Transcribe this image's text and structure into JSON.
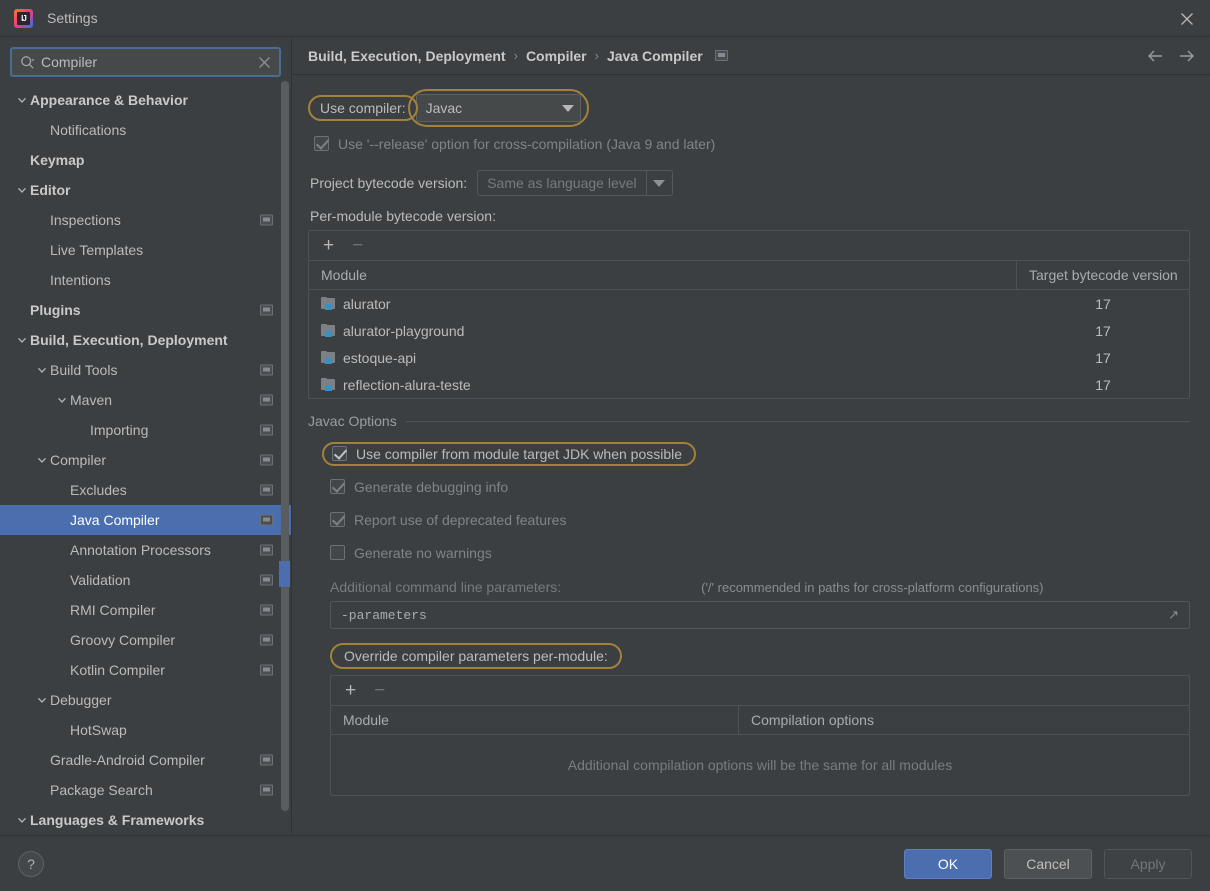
{
  "window": {
    "title": "Settings",
    "logo_icon": "intellij-idea-logo",
    "close_icon": "close-icon"
  },
  "search": {
    "value": "Compiler",
    "placeholder": "Search settings",
    "search_icon": "search-icon",
    "clear_icon": "clear-icon"
  },
  "sidebar": {
    "items": [
      {
        "label": "Appearance & Behavior",
        "indent": 0,
        "bold": true,
        "arrow": "chevron-down",
        "screen_icon": false,
        "selected": false
      },
      {
        "label": "Notifications",
        "indent": 1,
        "bold": false,
        "arrow": "none",
        "screen_icon": false,
        "selected": false
      },
      {
        "label": "Keymap",
        "indent": 0,
        "bold": true,
        "arrow": "none",
        "screen_icon": false,
        "selected": false
      },
      {
        "label": "Editor",
        "indent": 0,
        "bold": true,
        "arrow": "chevron-down",
        "screen_icon": false,
        "selected": false
      },
      {
        "label": "Inspections",
        "indent": 1,
        "bold": false,
        "arrow": "none",
        "screen_icon": true,
        "selected": false
      },
      {
        "label": "Live Templates",
        "indent": 1,
        "bold": false,
        "arrow": "none",
        "screen_icon": false,
        "selected": false
      },
      {
        "label": "Intentions",
        "indent": 1,
        "bold": false,
        "arrow": "none",
        "screen_icon": false,
        "selected": false
      },
      {
        "label": "Plugins",
        "indent": 0,
        "bold": true,
        "arrow": "none",
        "screen_icon": true,
        "selected": false
      },
      {
        "label": "Build, Execution, Deployment",
        "indent": 0,
        "bold": true,
        "arrow": "chevron-down",
        "screen_icon": false,
        "selected": false
      },
      {
        "label": "Build Tools",
        "indent": 1,
        "bold": false,
        "arrow": "chevron-down",
        "screen_icon": true,
        "selected": false
      },
      {
        "label": "Maven",
        "indent": 2,
        "bold": false,
        "arrow": "chevron-down",
        "screen_icon": true,
        "selected": false
      },
      {
        "label": "Importing",
        "indent": 3,
        "bold": false,
        "arrow": "none",
        "screen_icon": true,
        "selected": false
      },
      {
        "label": "Compiler",
        "indent": 1,
        "bold": false,
        "arrow": "chevron-down",
        "screen_icon": true,
        "selected": false
      },
      {
        "label": "Excludes",
        "indent": 2,
        "bold": false,
        "arrow": "none",
        "screen_icon": true,
        "selected": false
      },
      {
        "label": "Java Compiler",
        "indent": 2,
        "bold": false,
        "arrow": "none",
        "screen_icon": true,
        "selected": true
      },
      {
        "label": "Annotation Processors",
        "indent": 2,
        "bold": false,
        "arrow": "none",
        "screen_icon": true,
        "selected": false
      },
      {
        "label": "Validation",
        "indent": 2,
        "bold": false,
        "arrow": "none",
        "screen_icon": true,
        "selected": false
      },
      {
        "label": "RMI Compiler",
        "indent": 2,
        "bold": false,
        "arrow": "none",
        "screen_icon": true,
        "selected": false
      },
      {
        "label": "Groovy Compiler",
        "indent": 2,
        "bold": false,
        "arrow": "none",
        "screen_icon": true,
        "selected": false
      },
      {
        "label": "Kotlin Compiler",
        "indent": 2,
        "bold": false,
        "arrow": "none",
        "screen_icon": true,
        "selected": false
      },
      {
        "label": "Debugger",
        "indent": 1,
        "bold": false,
        "arrow": "chevron-down",
        "screen_icon": false,
        "selected": false
      },
      {
        "label": "HotSwap",
        "indent": 2,
        "bold": false,
        "arrow": "none",
        "screen_icon": false,
        "selected": false
      },
      {
        "label": "Gradle-Android Compiler",
        "indent": 1,
        "bold": false,
        "arrow": "none",
        "screen_icon": true,
        "selected": false
      },
      {
        "label": "Package Search",
        "indent": 1,
        "bold": false,
        "arrow": "none",
        "screen_icon": true,
        "selected": false
      },
      {
        "label": "Languages & Frameworks",
        "indent": 0,
        "bold": true,
        "arrow": "chevron-down",
        "screen_icon": false,
        "selected": false
      }
    ]
  },
  "breadcrumb": {
    "parts": [
      "Build, Execution, Deployment",
      "Compiler",
      "Java Compiler"
    ],
    "separator": "›",
    "screen_icon": "screen-icon",
    "back_icon": "arrow-left-icon",
    "forward_icon": "arrow-right-icon"
  },
  "main": {
    "use_compiler_label": "Use compiler:",
    "use_compiler_value": "Javac",
    "use_release_checkbox": {
      "label": "Use '--release' option for cross-compilation (Java 9 and later)",
      "checked": true,
      "enabled": false
    },
    "project_bytecode_label": "Project bytecode version:",
    "project_bytecode_value": "Same as language level",
    "per_module_label": "Per-module bytecode version:",
    "per_module_table": {
      "add_label": "+",
      "remove_label": "−",
      "columns": [
        "Module",
        "Target bytecode version"
      ],
      "rows": [
        {
          "module": "alurator",
          "version": "17"
        },
        {
          "module": "alurator-playground",
          "version": "17"
        },
        {
          "module": "estoque-api",
          "version": "17"
        },
        {
          "module": "reflection-alura-teste",
          "version": "17"
        }
      ]
    },
    "javac_options": {
      "title": "Javac Options",
      "checkboxes": [
        {
          "label": "Use compiler from module target JDK when possible",
          "checked": true,
          "enabled": true,
          "annotated": true
        },
        {
          "label": "Generate debugging info",
          "checked": true,
          "enabled": false,
          "annotated": false
        },
        {
          "label": "Report use of deprecated features",
          "checked": true,
          "enabled": false,
          "annotated": false
        },
        {
          "label": "Generate no warnings",
          "checked": false,
          "enabled": false,
          "annotated": false
        }
      ],
      "additional_params_label": "Additional command line parameters:",
      "additional_params_hint": "('/' recommended in paths for cross-platform configurations)",
      "additional_params_value": "-parameters",
      "expand_icon": "expand-icon",
      "override_label": "Override compiler parameters per-module:",
      "override_table": {
        "add_label": "+",
        "remove_label": "−",
        "columns": [
          "Module",
          "Compilation options"
        ],
        "empty_message": "Additional compilation options will be the same for all modules"
      }
    }
  },
  "footer": {
    "help_label": "?",
    "ok_label": "OK",
    "cancel_label": "Cancel",
    "apply_label": "Apply"
  },
  "colors": {
    "accent_blue": "#4b6eaf",
    "annotation_gold": "#a2813c",
    "background": "#3c3f41",
    "module_icon_accent": "#3592c4"
  }
}
